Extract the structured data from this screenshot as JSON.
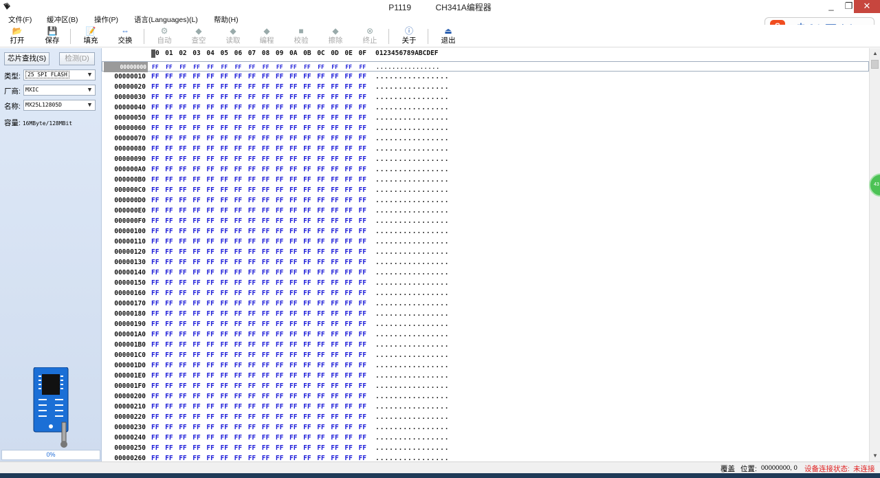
{
  "window": {
    "title_left": "P1119",
    "title_right": "CH341A编程器",
    "minimize_symbol": "_",
    "maximize_symbol": "❐",
    "close_symbol": "✕"
  },
  "menu": [
    "文件(F)",
    "缓冲区(B)",
    "操作(P)",
    "语言(Languages)(L)",
    "帮助(H)"
  ],
  "toolbar": [
    {
      "label": "打开",
      "icon": "open-folder-icon",
      "glyph": "📂",
      "enabled": true
    },
    {
      "label": "保存",
      "icon": "save-disk-icon",
      "glyph": "💾",
      "enabled": true
    },
    {
      "label": "填充",
      "icon": "fill-edit-icon",
      "glyph": "📝",
      "enabled": true
    },
    {
      "label": "交换",
      "icon": "swap-arrows-icon",
      "glyph": "⇔",
      "enabled": true
    },
    {
      "label": "自动",
      "icon": "auto-icon",
      "glyph": "⚙",
      "enabled": false
    },
    {
      "label": "查空",
      "icon": "blank-check-icon",
      "glyph": "◆",
      "enabled": false
    },
    {
      "label": "读取",
      "icon": "read-icon",
      "glyph": "◆",
      "enabled": false
    },
    {
      "label": "编程",
      "icon": "program-icon",
      "glyph": "◆",
      "enabled": false
    },
    {
      "label": "校验",
      "icon": "verify-icon",
      "glyph": "■",
      "enabled": false
    },
    {
      "label": "擦除",
      "icon": "erase-icon",
      "glyph": "◆",
      "enabled": false
    },
    {
      "label": "终止",
      "icon": "stop-icon",
      "glyph": "⊗",
      "enabled": false
    },
    {
      "label": "关于",
      "icon": "about-info-icon",
      "glyph": "ⓘ",
      "enabled": true
    },
    {
      "label": "退出",
      "icon": "exit-door-icon",
      "glyph": "⏏",
      "enabled": true
    }
  ],
  "ime": {
    "logo": "S",
    "text": "中 ☽ °, ⌨ ♟ ✎"
  },
  "left_panel": {
    "find_chip": "芯片查找(S)",
    "detect": "检测(D)",
    "type_label": "类型:",
    "type_value": "25 SPI FLASH",
    "vendor_label": "厂商:",
    "vendor_value": "MXIC",
    "name_label": "名称:",
    "name_value": "MX25L12805D",
    "capacity_label": "容量:",
    "capacity_value": "16MByte/128MBit",
    "progress_text": "0%",
    "progress": 0
  },
  "hex": {
    "header_cols": [
      "0",
      "01",
      "02",
      "03",
      "04",
      "05",
      "06",
      "07",
      "08",
      "09",
      "0A",
      "0B",
      "0C",
      "0D",
      "0E",
      "0F"
    ],
    "header_ascii": "0123456789ABCDEF",
    "byte_value": "FF",
    "ascii_row": "................",
    "addresses": [
      "00000000",
      "00000010",
      "00000020",
      "00000030",
      "00000040",
      "00000050",
      "00000060",
      "00000070",
      "00000080",
      "00000090",
      "000000A0",
      "000000B0",
      "000000C0",
      "000000D0",
      "000000E0",
      "000000F0",
      "00000100",
      "00000110",
      "00000120",
      "00000130",
      "00000140",
      "00000150",
      "00000160",
      "00000170",
      "00000180",
      "00000190",
      "000001A0",
      "000001B0",
      "000001C0",
      "000001D0",
      "000001E0",
      "000001F0",
      "00000200",
      "00000210",
      "00000220",
      "00000230",
      "00000240",
      "00000250",
      "00000260"
    ]
  },
  "side_badge": "43",
  "status": {
    "mode": "覆盖",
    "position_label": "位置:",
    "position_value": "00000000,  0",
    "conn_label": "设备连接状态:",
    "conn_value": "未连接"
  },
  "colors": {
    "hex_bytes": "#1a1ad8",
    "status_alert": "#e02020",
    "title_close": "#c7463e"
  }
}
